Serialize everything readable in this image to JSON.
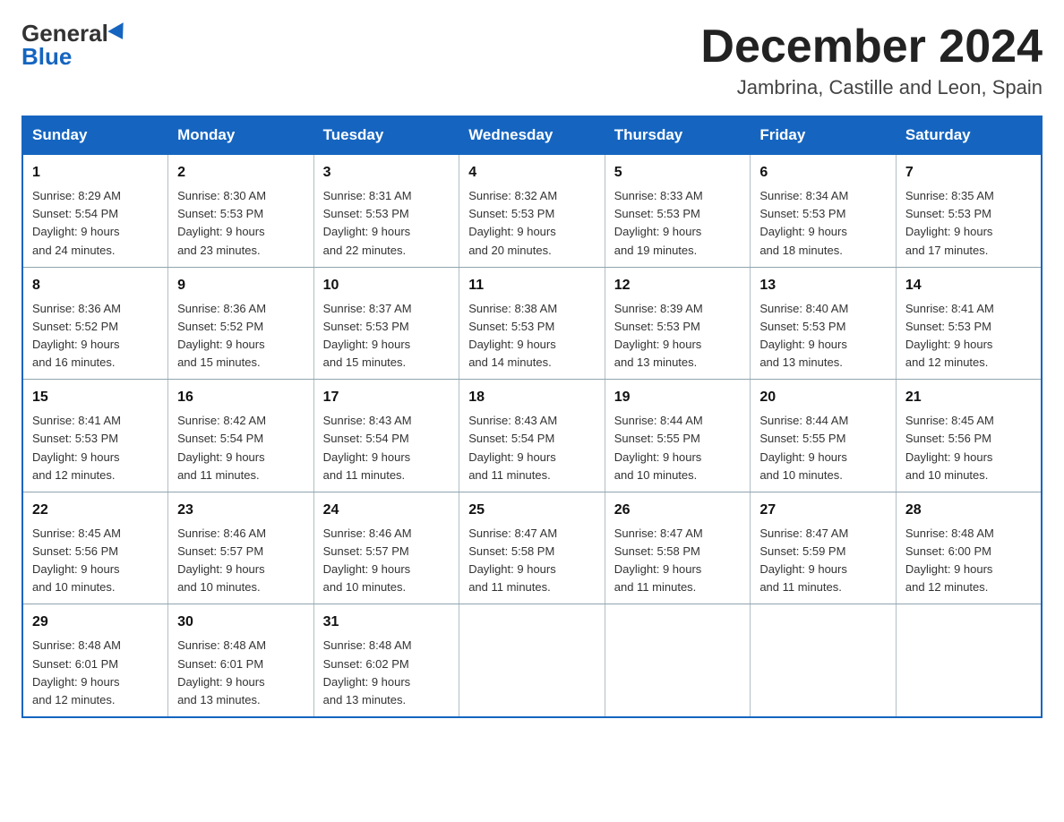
{
  "header": {
    "logo_general": "General",
    "logo_blue": "Blue",
    "month_title": "December 2024",
    "subtitle": "Jambrina, Castille and Leon, Spain"
  },
  "weekdays": [
    "Sunday",
    "Monday",
    "Tuesday",
    "Wednesday",
    "Thursday",
    "Friday",
    "Saturday"
  ],
  "weeks": [
    [
      {
        "day": "1",
        "sunrise": "8:29 AM",
        "sunset": "5:54 PM",
        "daylight": "9 hours and 24 minutes."
      },
      {
        "day": "2",
        "sunrise": "8:30 AM",
        "sunset": "5:53 PM",
        "daylight": "9 hours and 23 minutes."
      },
      {
        "day": "3",
        "sunrise": "8:31 AM",
        "sunset": "5:53 PM",
        "daylight": "9 hours and 22 minutes."
      },
      {
        "day": "4",
        "sunrise": "8:32 AM",
        "sunset": "5:53 PM",
        "daylight": "9 hours and 20 minutes."
      },
      {
        "day": "5",
        "sunrise": "8:33 AM",
        "sunset": "5:53 PM",
        "daylight": "9 hours and 19 minutes."
      },
      {
        "day": "6",
        "sunrise": "8:34 AM",
        "sunset": "5:53 PM",
        "daylight": "9 hours and 18 minutes."
      },
      {
        "day": "7",
        "sunrise": "8:35 AM",
        "sunset": "5:53 PM",
        "daylight": "9 hours and 17 minutes."
      }
    ],
    [
      {
        "day": "8",
        "sunrise": "8:36 AM",
        "sunset": "5:52 PM",
        "daylight": "9 hours and 16 minutes."
      },
      {
        "day": "9",
        "sunrise": "8:36 AM",
        "sunset": "5:52 PM",
        "daylight": "9 hours and 15 minutes."
      },
      {
        "day": "10",
        "sunrise": "8:37 AM",
        "sunset": "5:53 PM",
        "daylight": "9 hours and 15 minutes."
      },
      {
        "day": "11",
        "sunrise": "8:38 AM",
        "sunset": "5:53 PM",
        "daylight": "9 hours and 14 minutes."
      },
      {
        "day": "12",
        "sunrise": "8:39 AM",
        "sunset": "5:53 PM",
        "daylight": "9 hours and 13 minutes."
      },
      {
        "day": "13",
        "sunrise": "8:40 AM",
        "sunset": "5:53 PM",
        "daylight": "9 hours and 13 minutes."
      },
      {
        "day": "14",
        "sunrise": "8:41 AM",
        "sunset": "5:53 PM",
        "daylight": "9 hours and 12 minutes."
      }
    ],
    [
      {
        "day": "15",
        "sunrise": "8:41 AM",
        "sunset": "5:53 PM",
        "daylight": "9 hours and 12 minutes."
      },
      {
        "day": "16",
        "sunrise": "8:42 AM",
        "sunset": "5:54 PM",
        "daylight": "9 hours and 11 minutes."
      },
      {
        "day": "17",
        "sunrise": "8:43 AM",
        "sunset": "5:54 PM",
        "daylight": "9 hours and 11 minutes."
      },
      {
        "day": "18",
        "sunrise": "8:43 AM",
        "sunset": "5:54 PM",
        "daylight": "9 hours and 11 minutes."
      },
      {
        "day": "19",
        "sunrise": "8:44 AM",
        "sunset": "5:55 PM",
        "daylight": "9 hours and 10 minutes."
      },
      {
        "day": "20",
        "sunrise": "8:44 AM",
        "sunset": "5:55 PM",
        "daylight": "9 hours and 10 minutes."
      },
      {
        "day": "21",
        "sunrise": "8:45 AM",
        "sunset": "5:56 PM",
        "daylight": "9 hours and 10 minutes."
      }
    ],
    [
      {
        "day": "22",
        "sunrise": "8:45 AM",
        "sunset": "5:56 PM",
        "daylight": "9 hours and 10 minutes."
      },
      {
        "day": "23",
        "sunrise": "8:46 AM",
        "sunset": "5:57 PM",
        "daylight": "9 hours and 10 minutes."
      },
      {
        "day": "24",
        "sunrise": "8:46 AM",
        "sunset": "5:57 PM",
        "daylight": "9 hours and 10 minutes."
      },
      {
        "day": "25",
        "sunrise": "8:47 AM",
        "sunset": "5:58 PM",
        "daylight": "9 hours and 11 minutes."
      },
      {
        "day": "26",
        "sunrise": "8:47 AM",
        "sunset": "5:58 PM",
        "daylight": "9 hours and 11 minutes."
      },
      {
        "day": "27",
        "sunrise": "8:47 AM",
        "sunset": "5:59 PM",
        "daylight": "9 hours and 11 minutes."
      },
      {
        "day": "28",
        "sunrise": "8:48 AM",
        "sunset": "6:00 PM",
        "daylight": "9 hours and 12 minutes."
      }
    ],
    [
      {
        "day": "29",
        "sunrise": "8:48 AM",
        "sunset": "6:01 PM",
        "daylight": "9 hours and 12 minutes."
      },
      {
        "day": "30",
        "sunrise": "8:48 AM",
        "sunset": "6:01 PM",
        "daylight": "9 hours and 13 minutes."
      },
      {
        "day": "31",
        "sunrise": "8:48 AM",
        "sunset": "6:02 PM",
        "daylight": "9 hours and 13 minutes."
      },
      null,
      null,
      null,
      null
    ]
  ],
  "labels": {
    "sunrise": "Sunrise:",
    "sunset": "Sunset:",
    "daylight": "Daylight:"
  }
}
